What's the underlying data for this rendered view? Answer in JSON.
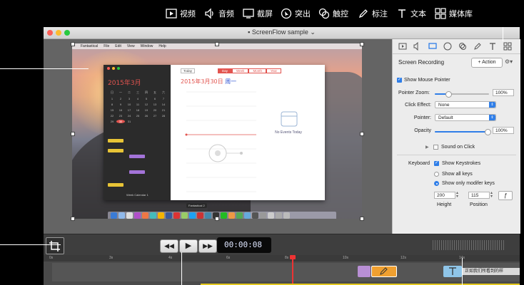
{
  "toolbar": {
    "items": [
      {
        "label": "视频",
        "icon": "video-icon"
      },
      {
        "label": "音频",
        "icon": "audio-icon"
      },
      {
        "label": "截屏",
        "icon": "screen-icon"
      },
      {
        "label": "突出",
        "icon": "highlight-icon"
      },
      {
        "label": "触控",
        "icon": "touch-icon"
      },
      {
        "label": "标注",
        "icon": "annotation-icon"
      },
      {
        "label": "文本",
        "icon": "text-icon"
      },
      {
        "label": "媒体库",
        "icon": "media-library-icon"
      }
    ]
  },
  "window": {
    "title": "ScreenFlow sample",
    "colors": {
      "close": "#fc5f57",
      "minimize": "#fdbc2e",
      "zoom": "#28c940"
    }
  },
  "screen": {
    "menubar": [
      "Fantastical",
      "File",
      "Edit",
      "View",
      "Window",
      "Help"
    ],
    "calendar": {
      "month_title": "2015年3月",
      "day_title": "2015年3月30日",
      "weekday": "周一",
      "today_btn": "Today",
      "views": [
        "Day",
        "Week",
        "Month",
        "Year"
      ],
      "no_events": "No Events Today",
      "dock_tip": "Fantastical 2",
      "footer": "Week Calendar 1"
    }
  },
  "inspector": {
    "section_title": "Screen Recording",
    "add_action": "+ Action",
    "show_mouse_pointer": "Show Mouse Pointer",
    "pointer_zoom_label": "Pointer Zoom:",
    "pointer_zoom_value": "100%",
    "click_effect_label": "Click Effect:",
    "click_effect_value": "None",
    "pointer_label": "Pointer:",
    "pointer_value": "Default",
    "opacity_label": "Opacity",
    "opacity_value": "100%",
    "sound_on_click": "Sound on Click",
    "keyboard_label": "Keyboard",
    "show_keystrokes": "Show Keystrokes",
    "show_all_keys": "Show all keys",
    "show_modifier_keys": "Show only modifer keys",
    "height_value": "200",
    "position_value": "115",
    "height_label": "Height",
    "position_label": "Position",
    "accent": "#2f7ee8"
  },
  "transport": {
    "rewind": "◀◀",
    "play": "▶",
    "forward": "▶▶",
    "timecode": "00:00:08",
    "frames": "08"
  },
  "timeline": {
    "ticks": [
      "0s",
      "3s",
      "4s",
      "6s",
      "8s",
      "10s",
      "12s",
      "14s"
    ],
    "text_clip": "正如我们所看到的样"
  }
}
